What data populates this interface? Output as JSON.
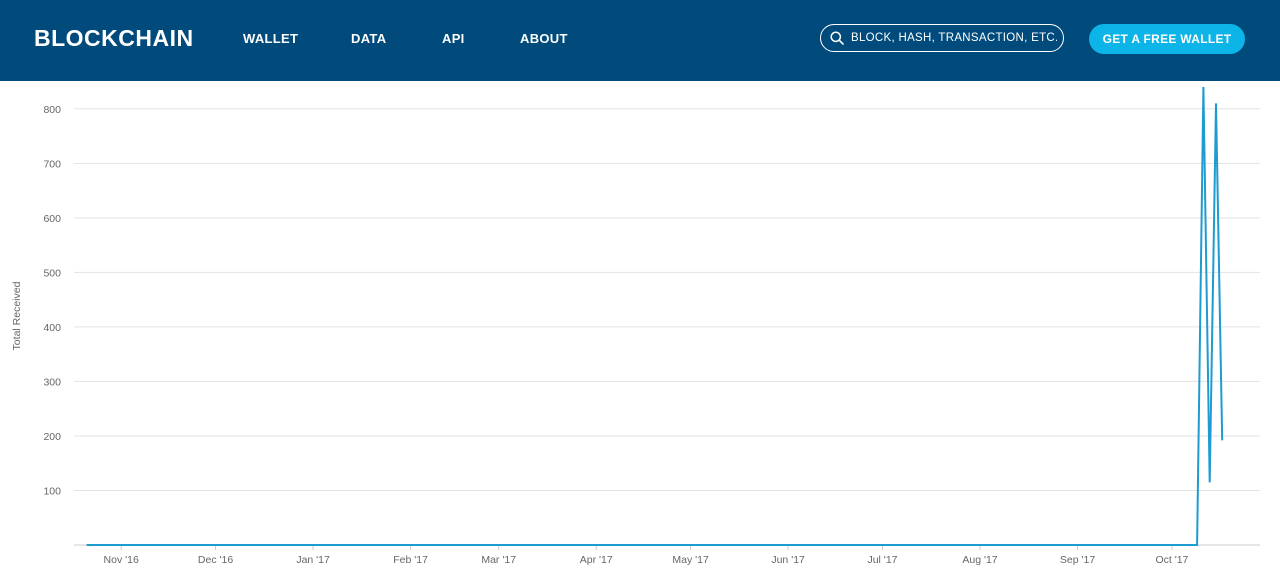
{
  "header": {
    "logo": "BLOCKCHAIN",
    "nav": [
      "WALLET",
      "DATA",
      "API",
      "ABOUT"
    ],
    "search_placeholder": "BLOCK, HASH, TRANSACTION, ETC...",
    "cta_label": "GET A FREE WALLET"
  },
  "colors": {
    "nav_bg": "#004a7c",
    "accent": "#0cb4e8",
    "series": "#1e9bd0"
  },
  "icons": {
    "search": "search-icon"
  },
  "chart_data": {
    "type": "line",
    "ylabel": "Total Received",
    "xlim": [
      "2016-10-17",
      "2017-10-29"
    ],
    "ylim": [
      0,
      840
    ],
    "yticks": [
      100,
      200,
      300,
      400,
      500,
      600,
      700,
      800
    ],
    "xticks": [
      {
        "date": "2016-11-01",
        "label": "Nov '16"
      },
      {
        "date": "2016-12-01",
        "label": "Dec '16"
      },
      {
        "date": "2017-01-01",
        "label": "Jan '17"
      },
      {
        "date": "2017-02-01",
        "label": "Feb '17"
      },
      {
        "date": "2017-03-01",
        "label": "Mar '17"
      },
      {
        "date": "2017-04-01",
        "label": "Apr '17"
      },
      {
        "date": "2017-05-01",
        "label": "May '17"
      },
      {
        "date": "2017-06-01",
        "label": "Jun '17"
      },
      {
        "date": "2017-07-01",
        "label": "Jul '17"
      },
      {
        "date": "2017-08-01",
        "label": "Aug '17"
      },
      {
        "date": "2017-09-01",
        "label": "Sep '17"
      },
      {
        "date": "2017-10-01",
        "label": "Oct '17"
      }
    ],
    "grid": true,
    "series": [
      {
        "x": [
          "2016-10-21",
          "2017-10-09",
          "2017-10-11",
          "2017-10-13",
          "2017-10-15",
          "2017-10-17"
        ],
        "y": [
          0,
          0,
          840,
          115,
          810,
          192
        ]
      }
    ]
  }
}
